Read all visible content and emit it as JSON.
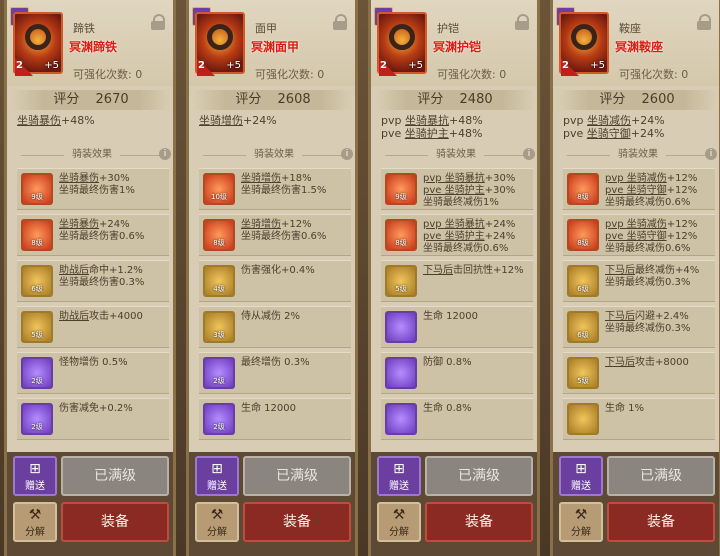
{
  "panels": [
    {
      "name": "蹄铁",
      "sub": "冥渊蹄铁",
      "level": "2",
      "plus": "+5",
      "enhance": "可强化次数: 0",
      "score_label": "评分",
      "score": "2670",
      "stats": [
        {
          "pre": "",
          "u": "坐骑暴伤",
          "post": "+48%"
        }
      ],
      "section": "骑装效果",
      "effects": [
        {
          "lv": "9级",
          "lines": [
            {
              "u": "坐骑暴伤",
              "post": "+30%"
            },
            {
              "u": "",
              "post": "坐骑最终伤害1%"
            }
          ]
        },
        {
          "lv": "8级",
          "lines": [
            {
              "u": "坐骑暴伤",
              "post": "+24%"
            },
            {
              "u": "",
              "post": "坐骑最终伤害0.6%"
            }
          ]
        },
        {
          "lv": "6级",
          "lines": [
            {
              "u": "助战后",
              "post": "命中+1.2%"
            },
            {
              "u": "",
              "post": "坐骑最终伤害0.3%"
            }
          ]
        },
        {
          "lv": "5级",
          "lines": [
            {
              "u": "助战后",
              "post": "攻击+4000"
            }
          ]
        },
        {
          "lv": "2级",
          "lines": [
            {
              "u": "",
              "post": "怪物增伤 0.5%"
            }
          ]
        },
        {
          "lv": "2级",
          "lines": [
            {
              "u": "",
              "post": "伤害减免+0.2%"
            }
          ]
        }
      ],
      "buttons": {
        "gift": "赠送",
        "maxed": "已满级",
        "decompose": "分解",
        "equip": "装备"
      }
    },
    {
      "name": "面甲",
      "sub": "冥渊面甲",
      "level": "2",
      "plus": "+5",
      "enhance": "可强化次数: 0",
      "score_label": "评分",
      "score": "2608",
      "stats": [
        {
          "pre": "",
          "u": "坐骑增伤",
          "post": "+24%"
        }
      ],
      "section": "骑装效果",
      "effects": [
        {
          "lv": "10级",
          "lines": [
            {
              "u": "坐骑增伤",
              "post": "+18%"
            },
            {
              "u": "",
              "post": "坐骑最终伤害1.5%"
            }
          ]
        },
        {
          "lv": "8级",
          "lines": [
            {
              "u": "坐骑增伤",
              "post": "+12%"
            },
            {
              "u": "",
              "post": "坐骑最终伤害0.6%"
            }
          ]
        },
        {
          "lv": "4级",
          "lines": [
            {
              "u": "",
              "post": "伤害强化+0.4%"
            }
          ]
        },
        {
          "lv": "3级",
          "lines": [
            {
              "u": "",
              "post": "侍从减伤 2%"
            }
          ]
        },
        {
          "lv": "2级",
          "lines": [
            {
              "u": "",
              "post": "最终增伤 0.3%"
            }
          ]
        },
        {
          "lv": "2级",
          "lines": [
            {
              "u": "",
              "post": "生命 12000"
            }
          ]
        }
      ],
      "buttons": {
        "gift": "赠送",
        "maxed": "已满级",
        "decompose": "分解",
        "equip": "装备"
      }
    },
    {
      "name": "护铠",
      "sub": "冥渊护铠",
      "level": "2",
      "plus": "+5",
      "enhance": "可强化次数: 0",
      "score_label": "评分",
      "score": "2480",
      "stats": [
        {
          "pre": "pvp ",
          "u": "坐骑暴抗",
          "post": "+48%"
        },
        {
          "pre": "pve ",
          "u": "坐骑护主",
          "post": "+48%"
        }
      ],
      "section": "骑装效果",
      "effects": [
        {
          "lv": "9级",
          "lines": [
            {
              "u": "pvp 坐骑暴抗",
              "post": "+30%"
            },
            {
              "u": "pve 坐骑护主",
              "post": "+30%"
            },
            {
              "u": "",
              "post": "坐骑最终减伤1%"
            }
          ]
        },
        {
          "lv": "8级",
          "lines": [
            {
              "u": "pvp 坐骑暴抗",
              "post": "+24%"
            },
            {
              "u": "pve 坐骑护主",
              "post": "+24%"
            },
            {
              "u": "",
              "post": "坐骑最终减伤0.6%"
            }
          ]
        },
        {
          "lv": "5级",
          "lines": [
            {
              "u": "下马后",
              "post": "击回抗性+12%"
            }
          ]
        },
        {
          "lv": "",
          "lines": [
            {
              "u": "",
              "post": "生命 12000"
            }
          ]
        },
        {
          "lv": "",
          "lines": [
            {
              "u": "",
              "post": "防御 0.8%"
            }
          ]
        },
        {
          "lv": "",
          "lines": [
            {
              "u": "",
              "post": "生命 0.8%"
            }
          ]
        }
      ],
      "buttons": {
        "gift": "赠送",
        "maxed": "已满级",
        "decompose": "分解",
        "equip": "装备"
      }
    },
    {
      "name": "鞍座",
      "sub": "冥渊鞍座",
      "level": "2",
      "plus": "+5",
      "enhance": "可强化次数: 0",
      "score_label": "评分",
      "score": "2600",
      "stats": [
        {
          "pre": "pvp ",
          "u": "坐骑减伤",
          "post": "+24%"
        },
        {
          "pre": "pve ",
          "u": "坐骑守御",
          "post": "+24%"
        }
      ],
      "section": "骑装效果",
      "effects": [
        {
          "lv": "8级",
          "lines": [
            {
              "u": "pvp 坐骑减伤",
              "post": "+12%"
            },
            {
              "u": "pve 坐骑守御",
              "post": "+12%"
            },
            {
              "u": "",
              "post": "坐骑最终减伤0.6%"
            }
          ]
        },
        {
          "lv": "8级",
          "lines": [
            {
              "u": "pvp 坐骑减伤",
              "post": "+12%"
            },
            {
              "u": "pve 坐骑守御",
              "post": "+12%"
            },
            {
              "u": "",
              "post": "坐骑最终减伤0.6%"
            }
          ]
        },
        {
          "lv": "6级",
          "lines": [
            {
              "u": "下马后",
              "post": "最终减伤+4%"
            },
            {
              "u": "",
              "post": "坐骑最终减伤0.3%"
            }
          ]
        },
        {
          "lv": "6级",
          "lines": [
            {
              "u": "下马后",
              "post": "闪避+2.4%"
            },
            {
              "u": "",
              "post": "坐骑最终减伤0.3%"
            }
          ]
        },
        {
          "lv": "5级",
          "lines": [
            {
              "u": "下马后",
              "post": "攻击+8000"
            }
          ]
        },
        {
          "lv": "",
          "lines": [
            {
              "u": "",
              "post": "生命 1%"
            }
          ]
        }
      ],
      "buttons": {
        "gift": "赠送",
        "maxed": "已满级",
        "decompose": "分解",
        "equip": "装备"
      }
    }
  ]
}
